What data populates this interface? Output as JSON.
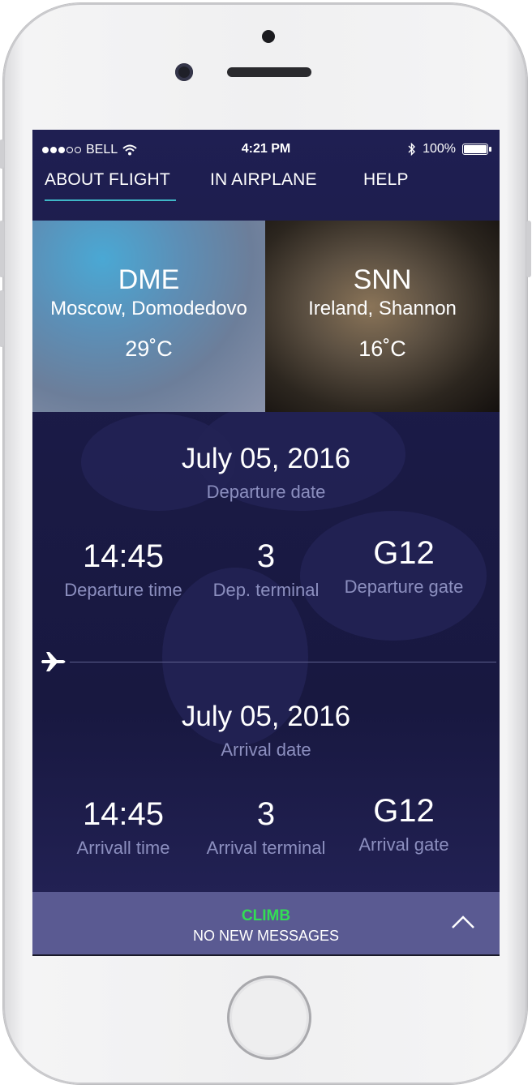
{
  "status_bar": {
    "carrier": "BELL",
    "time": "4:21 PM",
    "battery": "100%"
  },
  "tabs": [
    {
      "label": "ABOUT FLIGHT",
      "active": true
    },
    {
      "label": "IN AIRPLANE",
      "active": false
    },
    {
      "label": "HELP",
      "active": false
    }
  ],
  "origin": {
    "code": "DME",
    "city": "Moscow, Domodedovo",
    "temp": "29˚C"
  },
  "destination": {
    "code": "SNN",
    "city": "Ireland, Shannon",
    "temp": "16˚C"
  },
  "departure": {
    "date": "July 05, 2016",
    "date_label": "Departure date",
    "time": "14:45",
    "time_label": "Departure time",
    "terminal": "3",
    "terminal_label": "Dep. terminal",
    "gate": "G12",
    "gate_label": "Departure gate"
  },
  "arrival": {
    "date": "July 05, 2016",
    "date_label": "Arrival date",
    "time": "14:45",
    "time_label": "Arrivall time",
    "terminal": "3",
    "terminal_label": "Arrival terminal",
    "gate": "G12",
    "gate_label": "Arrival gate"
  },
  "bottom_bar": {
    "stage": "CLIMB",
    "message": "NO NEW MESSAGES"
  },
  "colors": {
    "accent_underline": "#3fb8c8",
    "stage_green": "#33dd55",
    "screen_bg": "#1c1c4a",
    "bar_bg": "#5a5a92"
  },
  "icons": [
    "wifi-icon",
    "bluetooth-icon",
    "battery-icon",
    "airplane-icon",
    "chevron-up-icon"
  ]
}
